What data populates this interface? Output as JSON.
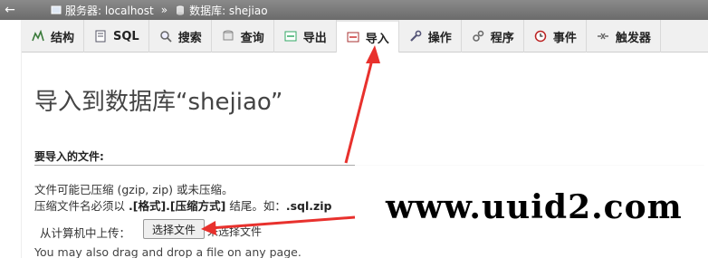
{
  "breadcrumb": {
    "server_label": "服务器: localhost",
    "separator": "»",
    "db_label": "数据库: shejiao"
  },
  "tabs": [
    {
      "label": "结构",
      "icon": "structure-icon"
    },
    {
      "label": "SQL",
      "icon": "sql-icon"
    },
    {
      "label": "搜索",
      "icon": "search-icon"
    },
    {
      "label": "查询",
      "icon": "query-icon"
    },
    {
      "label": "导出",
      "icon": "export-icon"
    },
    {
      "label": "导入",
      "icon": "import-icon",
      "active": true
    },
    {
      "label": "操作",
      "icon": "wrench-icon"
    },
    {
      "label": "程序",
      "icon": "routines-icon"
    },
    {
      "label": "事件",
      "icon": "clock-icon"
    },
    {
      "label": "触发器",
      "icon": "trigger-icon"
    }
  ],
  "main": {
    "title": "导入到数据库“shejiao”",
    "section_header": "要导入的文件:",
    "info_line1": "文件可能已压缩 (gzip, zip) 或未压缩。",
    "info_line2_prefix": "压缩文件名必须以 ",
    "info_line2_bold": ".[格式].[压缩方式]",
    "info_line2_mid": " 结尾。如：",
    "info_line2_example": ".sql.zip",
    "upload_label": "从计算机中上传：",
    "choose_file_button": "选择文件",
    "no_file_text": "未选择文件",
    "drag_note": "You may also drag and drop a file on any page."
  },
  "watermark": "www.uuid2.com",
  "colors": {
    "topbar": "#7a7a7a",
    "arrow": "#e8312d",
    "tab_bg": "#f0f0f0"
  }
}
